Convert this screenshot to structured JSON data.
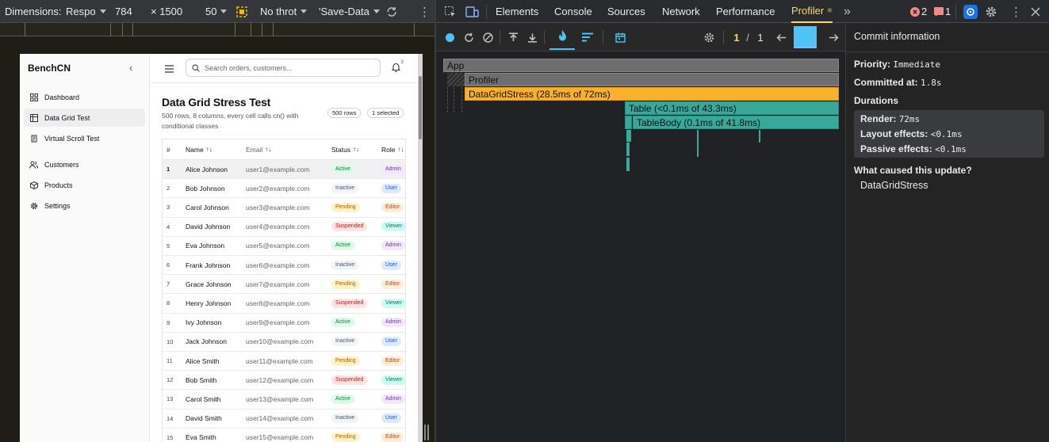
{
  "device_toolbar": {
    "dimensions_label": "Dimensions:",
    "dimensions_value": "Respo",
    "width": "784",
    "height_prefix": "×",
    "height": "1500",
    "zoom": "50",
    "throttle": "No throt",
    "save_data": "'Save-Data"
  },
  "app": {
    "brand": "BenchCN",
    "collapse_glyph": "‹",
    "nav": [
      {
        "label": "Dashboard",
        "icon": "dashboard-icon"
      },
      {
        "label": "Data Grid Test",
        "icon": "table-icon",
        "active": true
      },
      {
        "label": "Virtual Scroll Test",
        "icon": "scroll-icon"
      },
      {
        "label": "Customers",
        "icon": "users-icon"
      },
      {
        "label": "Products",
        "icon": "package-icon"
      },
      {
        "label": "Settings",
        "icon": "gear-icon"
      }
    ],
    "search_placeholder": "Search orders, customers...",
    "notification_count": "3",
    "page_title": "Data Grid Stress Test",
    "page_subtitle": "500 rows, 8 columns, every cell calls cn() with conditional classes",
    "rows_pill": "500 rows",
    "selected_pill": "1 selected",
    "columns": [
      "#",
      "Name",
      "Email",
      "Status",
      "Role"
    ],
    "sort_glyph": "↑↓",
    "rows": [
      {
        "n": "1",
        "name": "Alice Johnson",
        "email": "user1@example.com",
        "status": "Active",
        "role": "Admin"
      },
      {
        "n": "2",
        "name": "Bob Johnson",
        "email": "user2@example.com",
        "status": "Inactive",
        "role": "User"
      },
      {
        "n": "3",
        "name": "Carol Johnson",
        "email": "user3@example.com",
        "status": "Pending",
        "role": "Editor"
      },
      {
        "n": "4",
        "name": "David Johnson",
        "email": "user4@example.com",
        "status": "Suspended",
        "role": "Viewer"
      },
      {
        "n": "5",
        "name": "Eva Johnson",
        "email": "user5@example.com",
        "status": "Active",
        "role": "Admin"
      },
      {
        "n": "6",
        "name": "Frank Johnson",
        "email": "user6@example.com",
        "status": "Inactive",
        "role": "User"
      },
      {
        "n": "7",
        "name": "Grace Johnson",
        "email": "user7@example.com",
        "status": "Pending",
        "role": "Editor"
      },
      {
        "n": "8",
        "name": "Henry Johnson",
        "email": "user8@example.com",
        "status": "Suspended",
        "role": "Viewer"
      },
      {
        "n": "9",
        "name": "Ivy Johnson",
        "email": "user9@example.com",
        "status": "Active",
        "role": "Admin"
      },
      {
        "n": "10",
        "name": "Jack Johnson",
        "email": "user10@example.com",
        "status": "Inactive",
        "role": "User"
      },
      {
        "n": "11",
        "name": "Alice Smith",
        "email": "user11@example.com",
        "status": "Pending",
        "role": "Editor"
      },
      {
        "n": "12",
        "name": "Bob Smith",
        "email": "user12@example.com",
        "status": "Suspended",
        "role": "Viewer"
      },
      {
        "n": "13",
        "name": "Carol Smith",
        "email": "user13@example.com",
        "status": "Active",
        "role": "Admin"
      },
      {
        "n": "14",
        "name": "David Smith",
        "email": "user14@example.com",
        "status": "Inactive",
        "role": "User"
      },
      {
        "n": "15",
        "name": "Eva Smith",
        "email": "user15@example.com",
        "status": "Pending",
        "role": "Editor"
      }
    ],
    "status_colors": {
      "Active": {
        "bg": "#dcfce7",
        "fg": "#15803d"
      },
      "Inactive": {
        "bg": "#f1f5f9",
        "fg": "#475569"
      },
      "Pending": {
        "bg": "#fef3c7",
        "fg": "#a16207"
      },
      "Suspended": {
        "bg": "#fee2e2",
        "fg": "#b91c1c"
      }
    },
    "role_colors": {
      "Admin": {
        "bg": "#f3e8ff",
        "fg": "#7e22ce"
      },
      "User": {
        "bg": "#dbeafe",
        "fg": "#1d4ed8"
      },
      "Editor": {
        "bg": "#ffedd5",
        "fg": "#c2410c"
      },
      "Viewer": {
        "bg": "#ccfbf1",
        "fg": "#0f766e"
      }
    }
  },
  "devtools": {
    "tabs": [
      "Elements",
      "Console",
      "Sources",
      "Network",
      "Performance",
      "Profiler"
    ],
    "active_tab": "Profiler",
    "more_tabs_glyph": "»",
    "error_count": "2",
    "warning_count": "1",
    "commit_index": "1",
    "commit_separator": "/",
    "commit_total": "1",
    "flame": {
      "app": "App",
      "profiler": "Profiler",
      "datagrid": "DataGridStress (28.5ms of 72ms)",
      "table": "Table (<0.1ms of 43.3ms)",
      "tablebody": "TableBody (0.1ms of 41.8ms)"
    },
    "commit_info": {
      "header": "Commit information",
      "priority_label": "Priority:",
      "priority_value": "Immediate",
      "committed_label": "Committed at:",
      "committed_value": "1.8s",
      "durations_label": "Durations",
      "render_label": "Render:",
      "render_value": "72ms",
      "layout_label": "Layout effects:",
      "layout_value": "<0.1ms",
      "passive_label": "Passive effects:",
      "passive_value": "<0.1ms",
      "cause_label": "What caused this update?",
      "cause_value": "DataGridStress"
    }
  }
}
